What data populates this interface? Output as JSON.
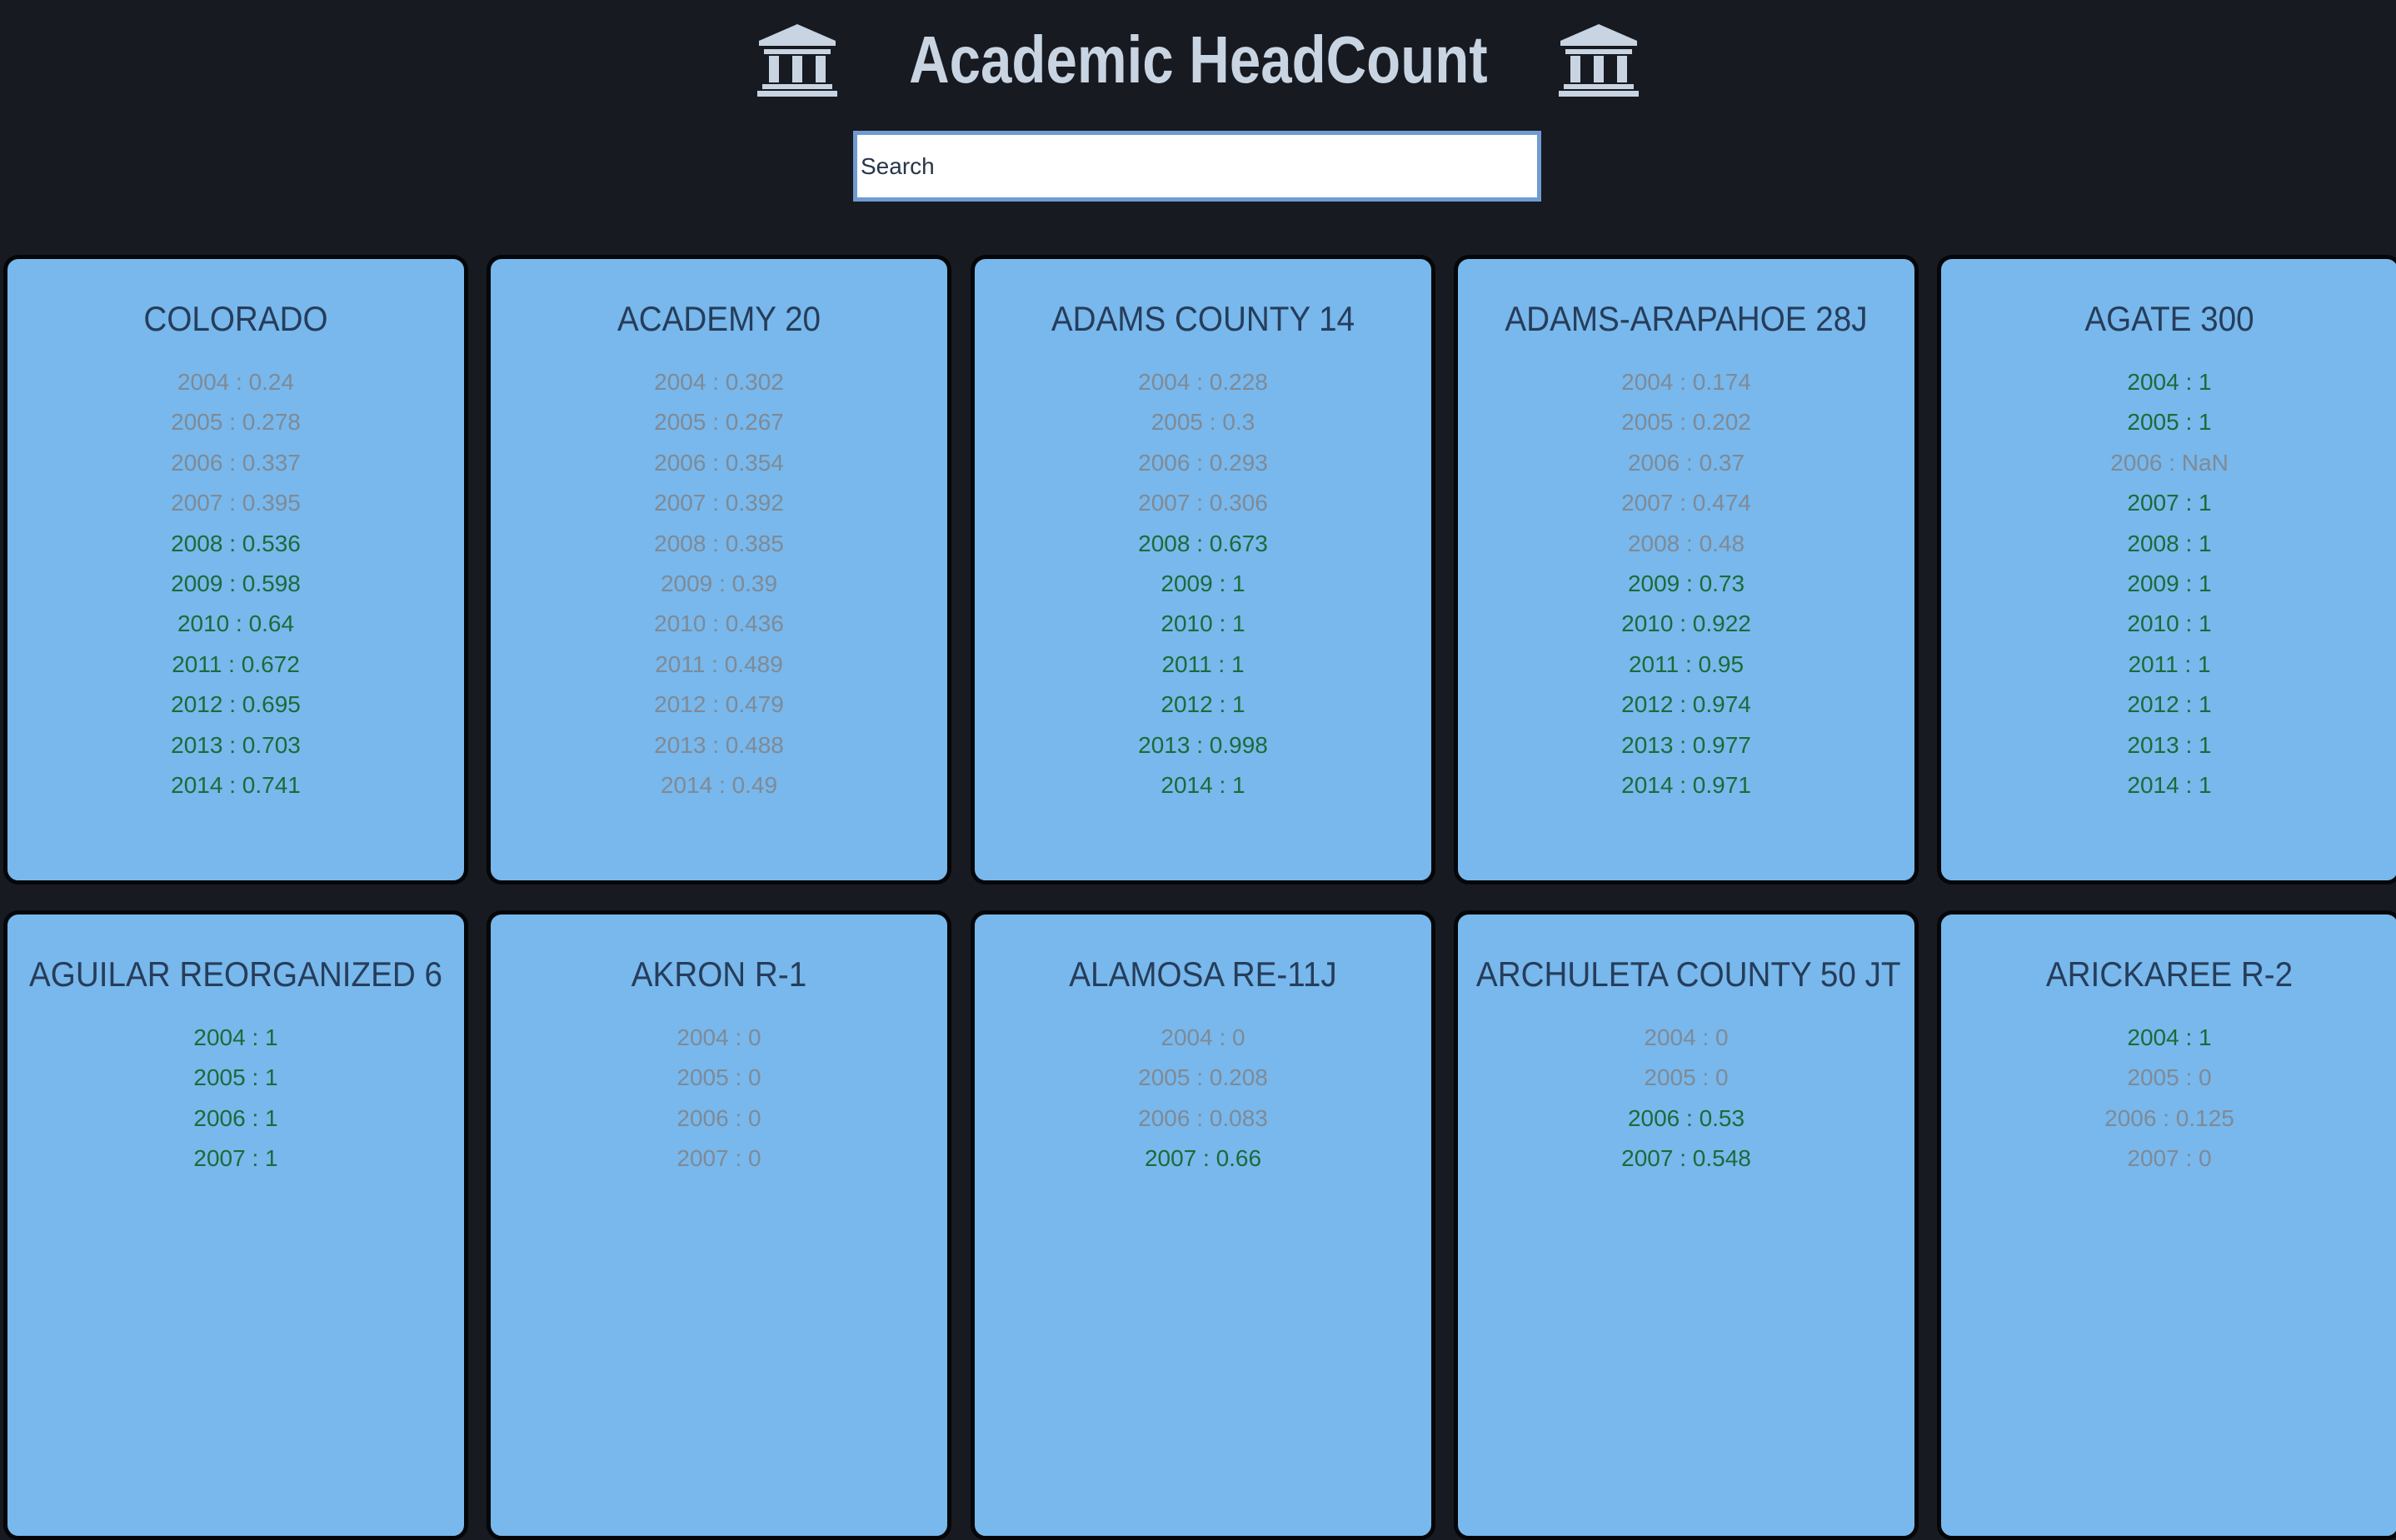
{
  "header": {
    "title": "Academic HeadCount",
    "icon": "bank-icon"
  },
  "search": {
    "placeholder": "Search"
  },
  "colors": {
    "background": "#171a21",
    "card": "#78b8ec",
    "card_title": "#263d5a",
    "value_high": "#1c6a3a",
    "value_low": "#7f8a96"
  },
  "cards": [
    {
      "title": "COLORADO",
      "entries": [
        {
          "text": "2004 : 0.24",
          "status": "low"
        },
        {
          "text": "2005 : 0.278",
          "status": "low"
        },
        {
          "text": "2006 : 0.337",
          "status": "low"
        },
        {
          "text": "2007 : 0.395",
          "status": "low"
        },
        {
          "text": "2008 : 0.536",
          "status": "high"
        },
        {
          "text": "2009 : 0.598",
          "status": "high"
        },
        {
          "text": "2010 : 0.64",
          "status": "high"
        },
        {
          "text": "2011 : 0.672",
          "status": "high"
        },
        {
          "text": "2012 : 0.695",
          "status": "high"
        },
        {
          "text": "2013 : 0.703",
          "status": "high"
        },
        {
          "text": "2014 : 0.741",
          "status": "high"
        }
      ]
    },
    {
      "title": "ACADEMY 20",
      "entries": [
        {
          "text": "2004 : 0.302",
          "status": "low"
        },
        {
          "text": "2005 : 0.267",
          "status": "low"
        },
        {
          "text": "2006 : 0.354",
          "status": "low"
        },
        {
          "text": "2007 : 0.392",
          "status": "low"
        },
        {
          "text": "2008 : 0.385",
          "status": "low"
        },
        {
          "text": "2009 : 0.39",
          "status": "low"
        },
        {
          "text": "2010 : 0.436",
          "status": "low"
        },
        {
          "text": "2011 : 0.489",
          "status": "low"
        },
        {
          "text": "2012 : 0.479",
          "status": "low"
        },
        {
          "text": "2013 : 0.488",
          "status": "low"
        },
        {
          "text": "2014 : 0.49",
          "status": "low"
        }
      ]
    },
    {
      "title": "ADAMS COUNTY 14",
      "entries": [
        {
          "text": "2004 : 0.228",
          "status": "low"
        },
        {
          "text": "2005 : 0.3",
          "status": "low"
        },
        {
          "text": "2006 : 0.293",
          "status": "low"
        },
        {
          "text": "2007 : 0.306",
          "status": "low"
        },
        {
          "text": "2008 : 0.673",
          "status": "high"
        },
        {
          "text": "2009 : 1",
          "status": "high"
        },
        {
          "text": "2010 : 1",
          "status": "high"
        },
        {
          "text": "2011 : 1",
          "status": "high"
        },
        {
          "text": "2012 : 1",
          "status": "high"
        },
        {
          "text": "2013 : 0.998",
          "status": "high"
        },
        {
          "text": "2014 : 1",
          "status": "high"
        }
      ]
    },
    {
      "title": "ADAMS-ARAPAHOE 28J",
      "entries": [
        {
          "text": "2004 : 0.174",
          "status": "low"
        },
        {
          "text": "2005 : 0.202",
          "status": "low"
        },
        {
          "text": "2006 : 0.37",
          "status": "low"
        },
        {
          "text": "2007 : 0.474",
          "status": "low"
        },
        {
          "text": "2008 : 0.48",
          "status": "low"
        },
        {
          "text": "2009 : 0.73",
          "status": "high"
        },
        {
          "text": "2010 : 0.922",
          "status": "high"
        },
        {
          "text": "2011 : 0.95",
          "status": "high"
        },
        {
          "text": "2012 : 0.974",
          "status": "high"
        },
        {
          "text": "2013 : 0.977",
          "status": "high"
        },
        {
          "text": "2014 : 0.971",
          "status": "high"
        }
      ]
    },
    {
      "title": "AGATE 300",
      "entries": [
        {
          "text": "2004 : 1",
          "status": "high"
        },
        {
          "text": "2005 : 1",
          "status": "high"
        },
        {
          "text": "2006 : NaN",
          "status": "low"
        },
        {
          "text": "2007 : 1",
          "status": "high"
        },
        {
          "text": "2008 : 1",
          "status": "high"
        },
        {
          "text": "2009 : 1",
          "status": "high"
        },
        {
          "text": "2010 : 1",
          "status": "high"
        },
        {
          "text": "2011 : 1",
          "status": "high"
        },
        {
          "text": "2012 : 1",
          "status": "high"
        },
        {
          "text": "2013 : 1",
          "status": "high"
        },
        {
          "text": "2014 : 1",
          "status": "high"
        }
      ]
    },
    {
      "title": "AGUILAR REORGANIZED 6",
      "entries": [
        {
          "text": "2004 : 1",
          "status": "high"
        },
        {
          "text": "2005 : 1",
          "status": "high"
        },
        {
          "text": "2006 : 1",
          "status": "high"
        },
        {
          "text": "2007 : 1",
          "status": "high"
        }
      ]
    },
    {
      "title": "AKRON R-1",
      "entries": [
        {
          "text": "2004 : 0",
          "status": "low"
        },
        {
          "text": "2005 : 0",
          "status": "low"
        },
        {
          "text": "2006 : 0",
          "status": "low"
        },
        {
          "text": "2007 : 0",
          "status": "low"
        }
      ]
    },
    {
      "title": "ALAMOSA RE-11J",
      "entries": [
        {
          "text": "2004 : 0",
          "status": "low"
        },
        {
          "text": "2005 : 0.208",
          "status": "low"
        },
        {
          "text": "2006 : 0.083",
          "status": "low"
        },
        {
          "text": "2007 : 0.66",
          "status": "high"
        }
      ]
    },
    {
      "title": "ARCHULETA COUNTY 50 JT",
      "entries": [
        {
          "text": "2004 : 0",
          "status": "low"
        },
        {
          "text": "2005 : 0",
          "status": "low"
        },
        {
          "text": "2006 : 0.53",
          "status": "high"
        },
        {
          "text": "2007 : 0.548",
          "status": "high"
        }
      ]
    },
    {
      "title": "ARICKAREE R-2",
      "entries": [
        {
          "text": "2004 : 1",
          "status": "high"
        },
        {
          "text": "2005 : 0",
          "status": "low"
        },
        {
          "text": "2006 : 0.125",
          "status": "low"
        },
        {
          "text": "2007 : 0",
          "status": "low"
        }
      ]
    }
  ]
}
